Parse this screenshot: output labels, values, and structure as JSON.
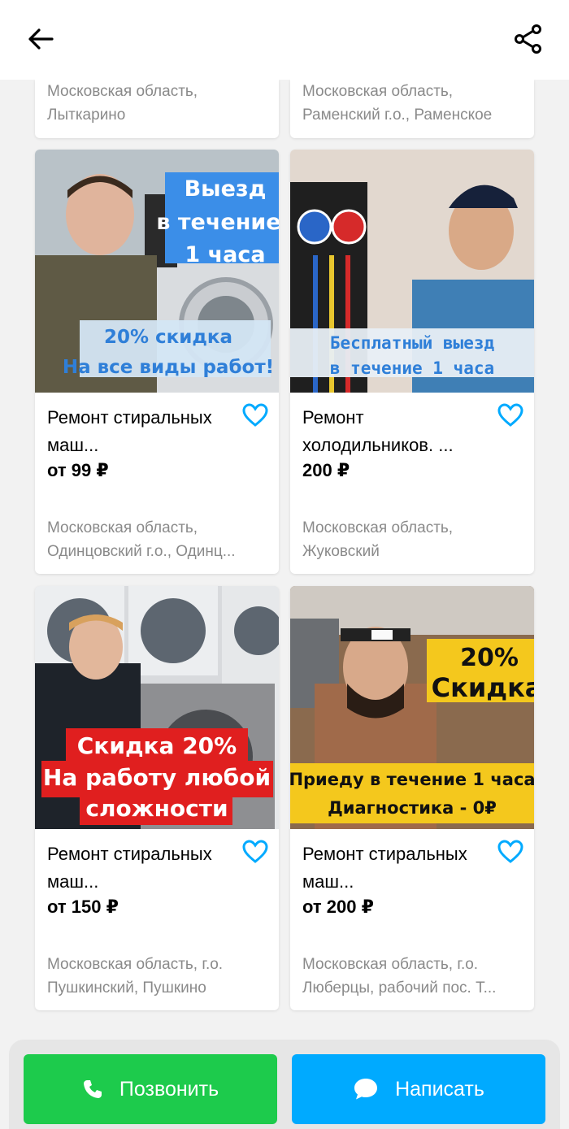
{
  "top_partial": [
    {
      "location": "Московская область, Лыткарино"
    },
    {
      "location": "Московская область, Раменский г.о., Раменское"
    }
  ],
  "cards": [
    {
      "title": "Ремонт стиральных маш...",
      "price": "от 99 ₽",
      "location": "Московская область, Одинцовский г.о., Одинц...",
      "overlay": [
        "Выезд",
        "в течение",
        "1 часа",
        "20% скидка",
        "На все виды работ!"
      ]
    },
    {
      "title": "Ремонт холодильников. ...",
      "price": "200 ₽",
      "location": "Московская область, Жуковский",
      "overlay": [
        "Бесплатный выезд",
        "в течение 1 часа"
      ]
    },
    {
      "title": "Ремонт стиральных маш...",
      "price": "от 150 ₽",
      "location": "Московская область, г.о. Пушкинский, Пушкино",
      "overlay": [
        "Скидка 20%",
        "На работу любой",
        "сложности"
      ]
    },
    {
      "title": "Ремонт стиральных маш...",
      "price": "от 200 ₽",
      "location": "Московская область, г.о. Люберцы, рабочий пос. Т...",
      "overlay": [
        "20%",
        "Скидка",
        "Приеду в течение 1 часа",
        "Диагностика - 0₽"
      ]
    }
  ],
  "actions": {
    "call_label": "Позвонить",
    "message_label": "Написать"
  },
  "colors": {
    "accent_blue": "#00aaff",
    "call_green": "#1dcb4c",
    "heart": "#00aaff"
  },
  "icons": {
    "back": "arrow-left-icon",
    "share": "share-icon",
    "favorite": "heart-icon",
    "phone": "phone-icon",
    "chat": "chat-bubble-icon"
  }
}
